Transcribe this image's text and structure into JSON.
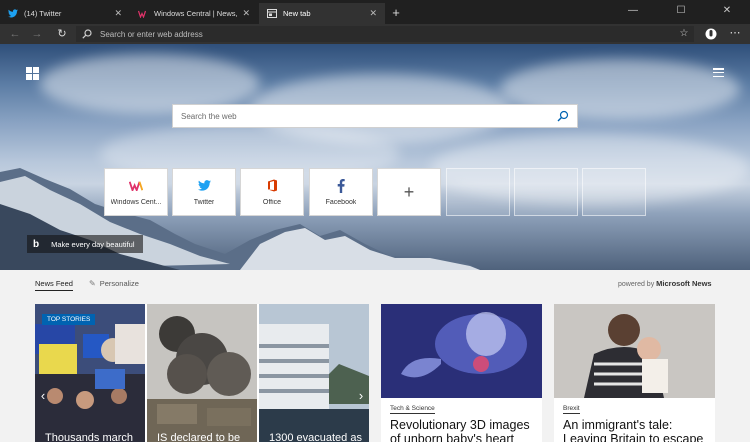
{
  "tabs": [
    {
      "label": "(14) Twitter",
      "icon": "twitter-icon",
      "active": false
    },
    {
      "label": "Windows Central | News, Forums",
      "icon": "windows-central-icon",
      "active": false
    },
    {
      "label": "New tab",
      "icon": "new-tab-icon",
      "active": true
    }
  ],
  "address": {
    "placeholder": "Search or enter web address"
  },
  "hero": {
    "search_placeholder": "Search the web",
    "bing_tagline": "Make every day beautiful",
    "bing_logo": "b"
  },
  "quick_links": [
    {
      "label": "Windows Cent...",
      "icon": "windows-central-icon"
    },
    {
      "label": "Twitter",
      "icon": "twitter-icon"
    },
    {
      "label": "Office",
      "icon": "office-icon"
    },
    {
      "label": "Facebook",
      "icon": "facebook-icon"
    }
  ],
  "news": {
    "feed_label": "News Feed",
    "personalize_label": "Personalize",
    "powered_prefix": "powered by",
    "powered_brand": "Microsoft News",
    "top_stories_badge": "TOP STORIES",
    "top_stories": [
      {
        "headline": "Thousands march"
      },
      {
        "headline": "IS declared to be"
      },
      {
        "headline": "1300 evacuated as"
      }
    ],
    "cards": [
      {
        "category": "Tech & Science",
        "headline": "Revolutionary 3D images of unborn baby's heart"
      },
      {
        "category": "Brexit",
        "headline": "An immigrant's tale: Leaving Britain to escape"
      }
    ]
  },
  "colors": {
    "accent": "#0063b1",
    "twitter": "#1da1f2",
    "office": "#d83b01",
    "facebook": "#3b5998"
  }
}
